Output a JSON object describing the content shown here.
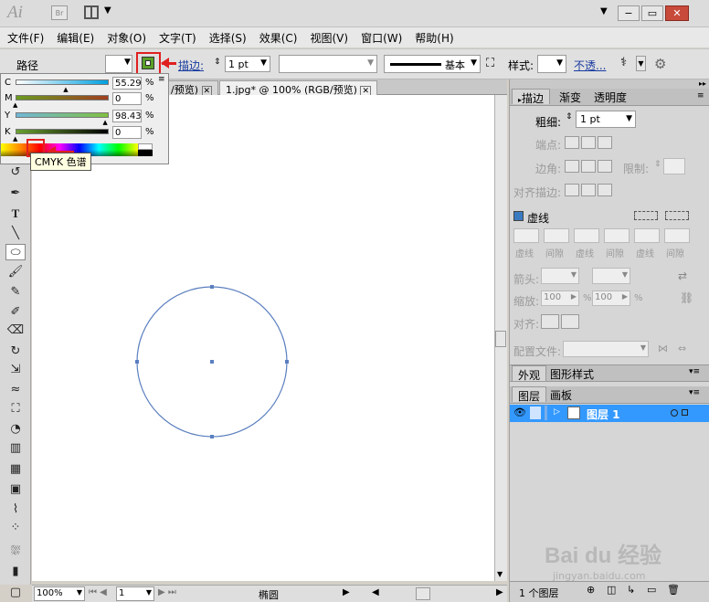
{
  "app": {
    "logo": "Ai",
    "bridge": "Br"
  },
  "window_controls": {
    "minimize": "−",
    "restore": "▭",
    "close": "✕"
  },
  "menu": [
    "文件(F)",
    "编辑(E)",
    "对象(O)",
    "文字(T)",
    "选择(S)",
    "效果(C)",
    "视图(V)",
    "窗口(W)",
    "帮助(H)"
  ],
  "control": {
    "object_type": "路径",
    "stroke_label": "描边:",
    "stroke_weight": "1 pt",
    "profile": "基本",
    "style_label": "样式:",
    "opacity_link": "不透..."
  },
  "color_panel": {
    "channels": [
      {
        "label": "C",
        "value": "55.29",
        "unit": "%",
        "level": 0.5529
      },
      {
        "label": "M",
        "value": "0",
        "unit": "%",
        "level": 0
      },
      {
        "label": "Y",
        "value": "98.43",
        "unit": "%",
        "level": 0.9843
      },
      {
        "label": "K",
        "value": "0",
        "unit": "%",
        "level": 0
      }
    ],
    "tooltip": "CMYK 色谱"
  },
  "tabs": {
    "prev_fragment": "/预览)",
    "active": "1.jpg* @ 100% (RGB/预览)"
  },
  "stroke_panel": {
    "tabs": [
      "描边",
      "渐变",
      "透明度"
    ],
    "weight_label": "粗细:",
    "weight_value": "1 pt",
    "cap_label": "端点:",
    "corner_label": "边角:",
    "limit_label": "限制:",
    "align_label": "对齐描边:",
    "dashed_label": "虚线",
    "dash_labels": [
      "虚线",
      "间隙",
      "虚线",
      "间隙",
      "虚线",
      "间隙"
    ],
    "arrow_label": "箭头:",
    "scale_label": "缩放:",
    "scale_1": "100",
    "scale_2": "100",
    "percent": "%",
    "align2_label": "对齐:",
    "profile_label": "配置文件:"
  },
  "appearance_panel": {
    "tabs": [
      "外观",
      "图形样式"
    ]
  },
  "layers_panel": {
    "tabs": [
      "图层",
      "画板"
    ],
    "layer_name": "图层 1",
    "footer": "1 个图层"
  },
  "status": {
    "zoom": "100%",
    "page": "1",
    "tool": "椭圆"
  },
  "watermark": {
    "text": "Bai du 经验",
    "url": "jingyan.baidu.com"
  },
  "colors": {
    "accent": "#3399ff",
    "highlight": "#e02020",
    "path": "#5b7fbf"
  }
}
